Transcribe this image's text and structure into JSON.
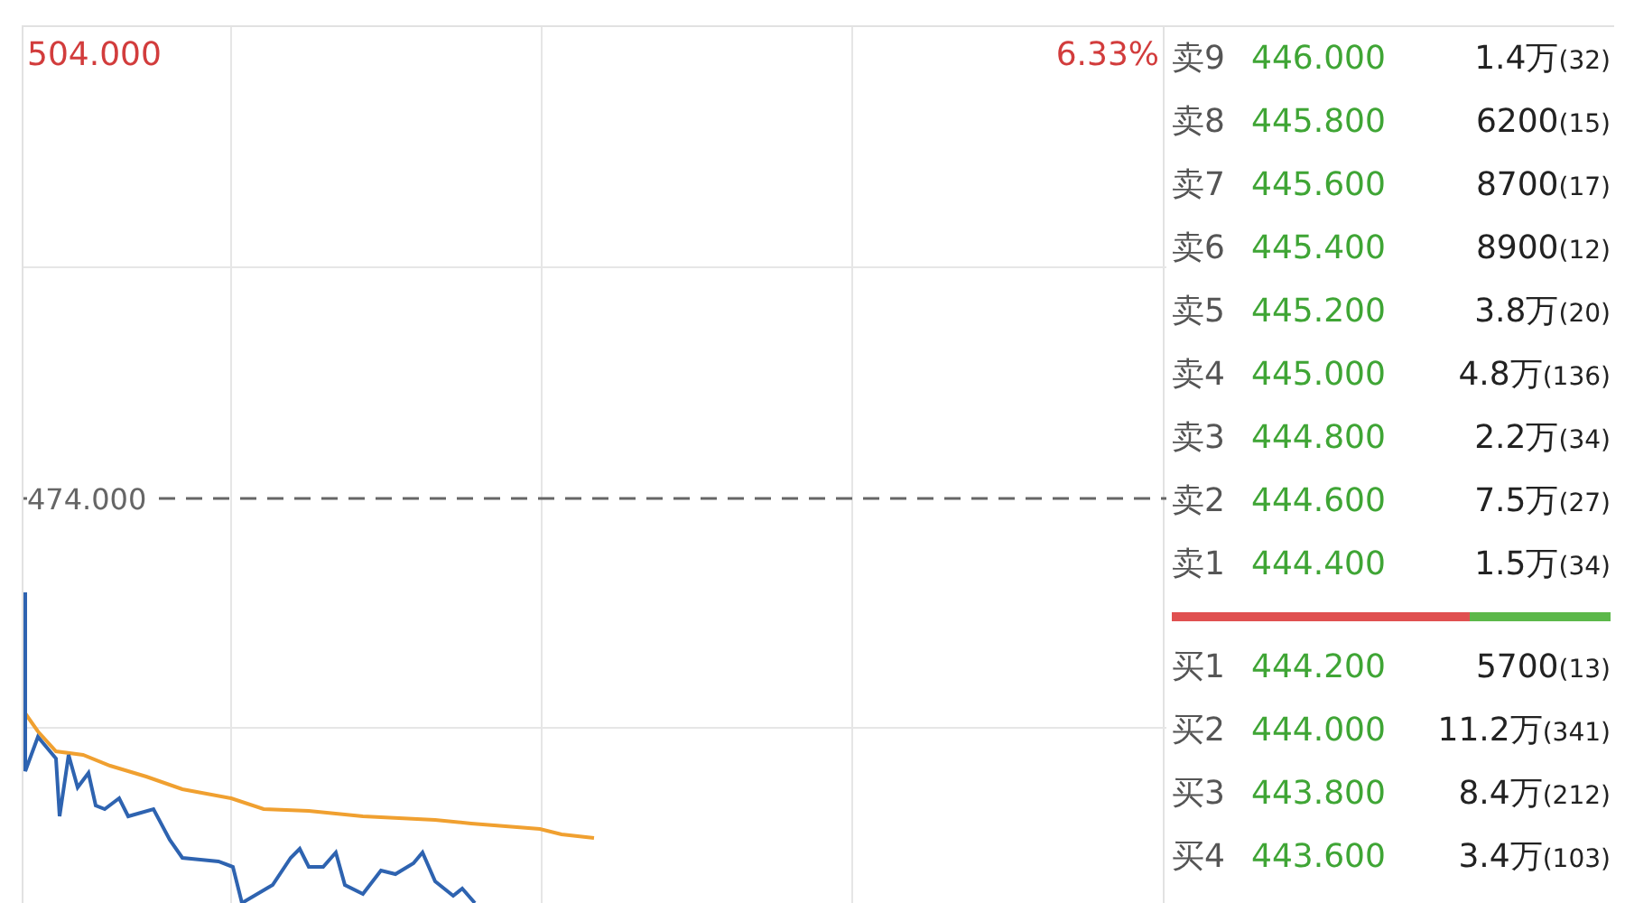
{
  "chart": {
    "top_price": "504.000",
    "top_change": "6.33%",
    "reference_price": "474.000"
  },
  "order_book": {
    "asks": [
      {
        "label": "卖9",
        "price": "446.000",
        "volume": "1.4万",
        "count": "(32)"
      },
      {
        "label": "卖8",
        "price": "445.800",
        "volume": "6200",
        "count": "(15)"
      },
      {
        "label": "卖7",
        "price": "445.600",
        "volume": "8700",
        "count": "(17)"
      },
      {
        "label": "卖6",
        "price": "445.400",
        "volume": "8900",
        "count": "(12)"
      },
      {
        "label": "卖5",
        "price": "445.200",
        "volume": "3.8万",
        "count": "(20)"
      },
      {
        "label": "卖4",
        "price": "445.000",
        "volume": "4.8万",
        "count": "(136)"
      },
      {
        "label": "卖3",
        "price": "444.800",
        "volume": "2.2万",
        "count": "(34)"
      },
      {
        "label": "卖2",
        "price": "444.600",
        "volume": "7.5万",
        "count": "(27)"
      },
      {
        "label": "卖1",
        "price": "444.400",
        "volume": "1.5万",
        "count": "(34)"
      }
    ],
    "ratio_bar": {
      "level": 0.68
    },
    "bids": [
      {
        "label": "买1",
        "price": "444.200",
        "volume": "5700",
        "count": "(13)"
      },
      {
        "label": "买2",
        "price": "444.000",
        "volume": "11.2万",
        "count": "(341)"
      },
      {
        "label": "买3",
        "price": "443.800",
        "volume": "8.4万",
        "count": "(212)"
      },
      {
        "label": "买4",
        "price": "443.600",
        "volume": "3.4万",
        "count": "(103)"
      }
    ]
  }
}
